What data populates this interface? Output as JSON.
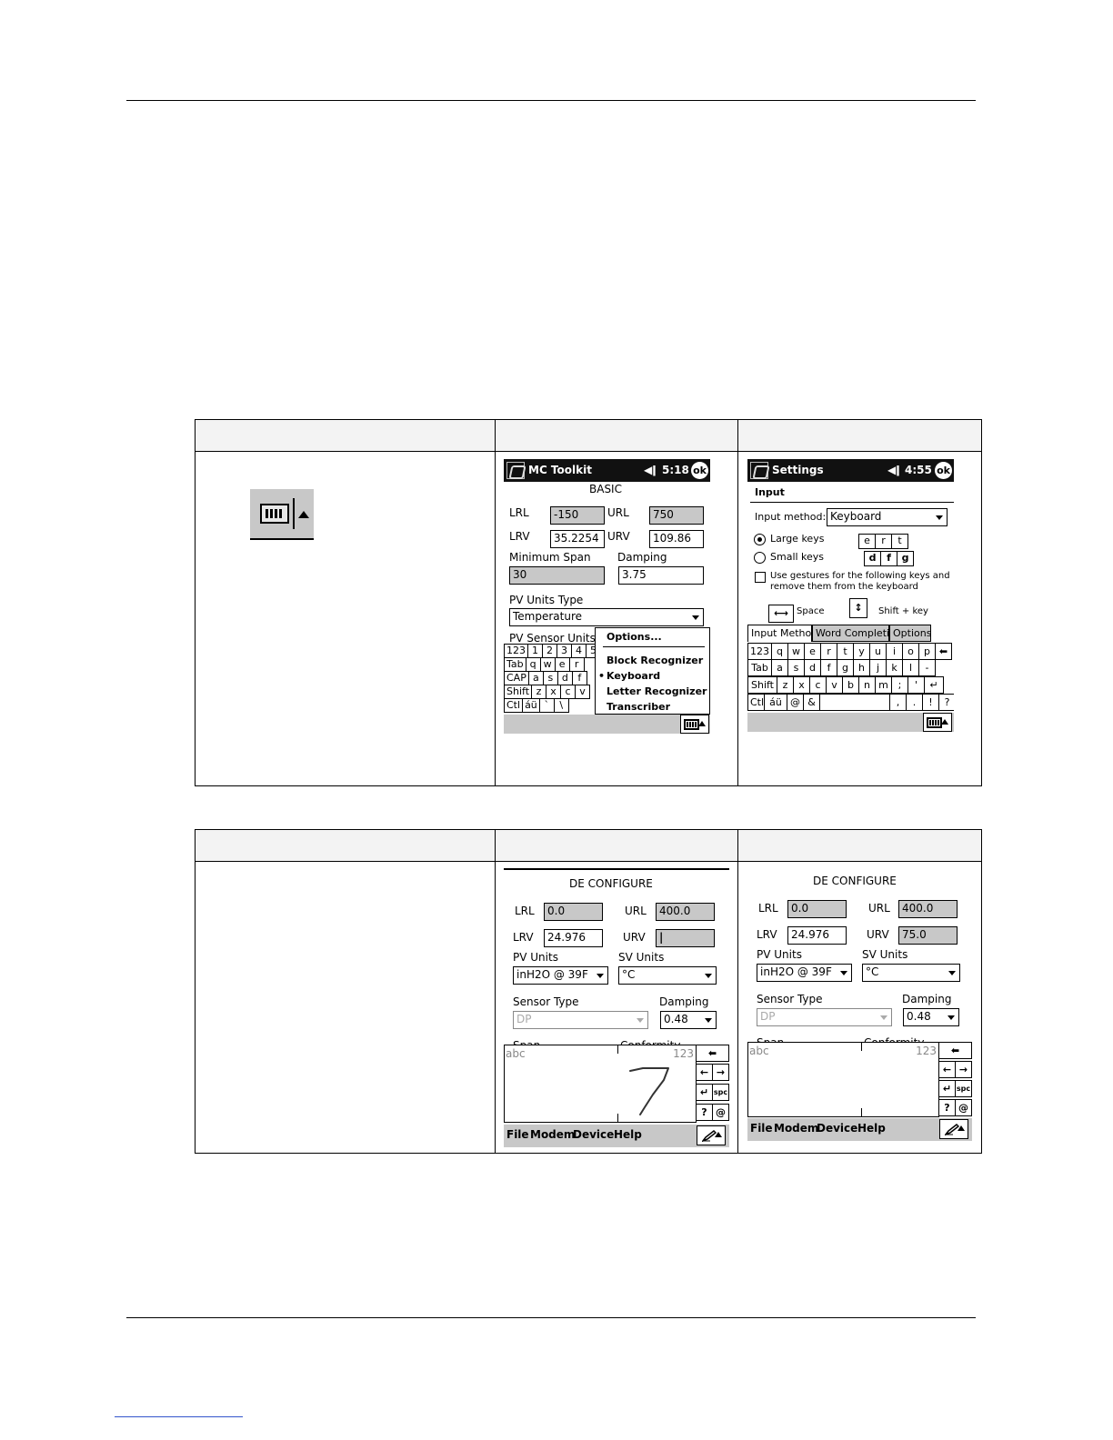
{
  "table1": {
    "s1": {
      "title": "MC Toolkit",
      "time": "5:18",
      "ok": "ok",
      "heading": "BASIC",
      "lrl_label": "LRL",
      "lrl": "-150",
      "url_label": "URL",
      "url": "750",
      "lrv_label": "LRV",
      "lrv": "35.2254",
      "urv_label": "URV",
      "urv": "109.86",
      "minspan_label": "Minimum Span",
      "minspan": "30",
      "damping_label": "Damping",
      "damping": "3.75",
      "pvut_label": "PV Units Type",
      "pvut": "Temperature",
      "pvsu_label": "PV Sensor Units",
      "kb": [
        [
          "123",
          "1",
          "2",
          "3",
          "4",
          "5"
        ],
        [
          "Tab",
          "q",
          "w",
          "e",
          "r"
        ],
        [
          "CAP",
          "a",
          "s",
          "d",
          "f"
        ],
        [
          "Shift",
          "z",
          "x",
          "c",
          "v"
        ],
        [
          "Ctl",
          "áü",
          "`",
          "\\"
        ]
      ],
      "menu": {
        "options": "Options...",
        "block": "Block Recognizer",
        "keyboard": "Keyboard",
        "letter": "Letter Recognizer",
        "transcriber": "Transcriber",
        "bullet": "•"
      }
    },
    "s2": {
      "title": "Settings",
      "time": "4:55",
      "ok": "ok",
      "heading": "Input",
      "method_label": "Input method:",
      "method": "Keyboard",
      "large": "Large keys",
      "small": "Small keys",
      "demo_row1": [
        "e",
        "r",
        "t"
      ],
      "demo_row2": [
        "d",
        "f",
        "g"
      ],
      "gesture_line1": "Use gestures for the following keys and",
      "gesture_line2": "remove them from the keyboard",
      "space": "Space",
      "shiftkey": "Shift + key",
      "tabs": [
        "Input Method",
        "Word Completion",
        "Options"
      ],
      "kb": [
        [
          "123",
          "q",
          "w",
          "e",
          "r",
          "t",
          "y",
          "u",
          "i",
          "o",
          "p",
          "⬅"
        ],
        [
          "Tab",
          "a",
          "s",
          "d",
          "f",
          "g",
          "h",
          "j",
          "k",
          "l",
          "-"
        ],
        [
          "Shift",
          "z",
          "x",
          "c",
          "v",
          "b",
          "n",
          "m",
          ";",
          "'",
          "↵"
        ],
        [
          "Ctl",
          "áü",
          "@",
          "&",
          "",
          ",",
          ".",
          "!",
          "?"
        ]
      ]
    }
  },
  "table2": {
    "s1": {
      "heading": "DE CONFIGURE",
      "lrl_label": "LRL",
      "lrl": "0.0",
      "url_label": "URL",
      "url": "400.0",
      "lrv_label": "LRV",
      "lrv": "24.976",
      "urv_label": "URV",
      "urv": "|",
      "pvu_label": "PV Units",
      "pvu": "inH2O @ 39F",
      "svu_label": "SV Units",
      "svu": "°C",
      "sensor_label": "Sensor Type",
      "sensor": "DP",
      "damp_label": "Damping",
      "damp": "0.48",
      "hw_abc": "abc",
      "hw_123": "123",
      "hw_keys": [
        "⬅",
        "←",
        "→",
        "↵",
        "spc",
        "?",
        "@"
      ],
      "menu": [
        "File",
        "Modem",
        "Device",
        "Help"
      ],
      "clip_left": "Span",
      "clip_right": "Conformity"
    },
    "s2": {
      "heading": "DE CONFIGURE",
      "lrl_label": "LRL",
      "lrl": "0.0",
      "url_label": "URL",
      "url": "400.0",
      "lrv_label": "LRV",
      "lrv": "24.976",
      "urv_label": "URV",
      "urv": "75.0",
      "pvu_label": "PV Units",
      "pvu": "inH2O @ 39F",
      "svu_label": "SV Units",
      "svu": "°C",
      "sensor_label": "Sensor Type",
      "sensor": "DP",
      "damp_label": "Damping",
      "damp": "0.48",
      "hw_abc": "abc",
      "hw_123": "123",
      "hw_keys": [
        "⬅",
        "←",
        "→",
        "↵",
        "spc",
        "?",
        "@"
      ],
      "menu": [
        "File",
        "Modem",
        "Device",
        "Help"
      ],
      "clip_left": "Span",
      "clip_right": "Conformity"
    }
  }
}
